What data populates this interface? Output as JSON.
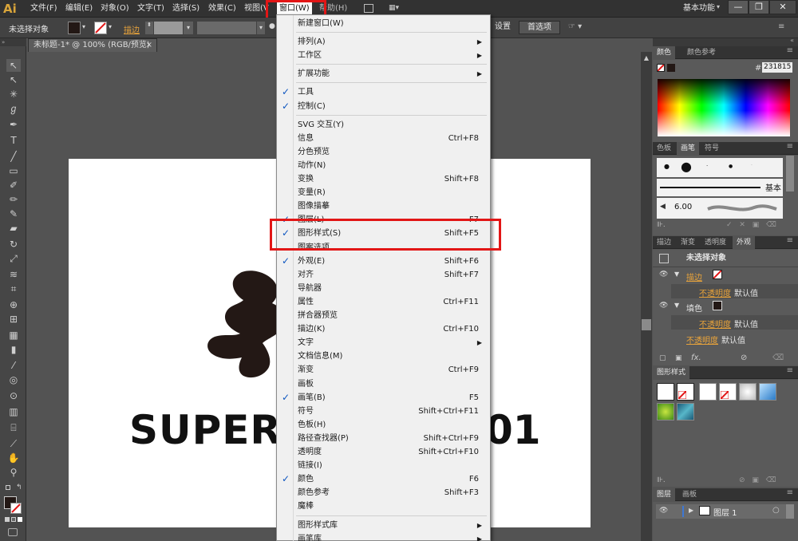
{
  "menubar": {
    "logo": "Ai",
    "items": [
      "文件(F)",
      "编辑(E)",
      "对象(O)",
      "文字(T)",
      "选择(S)",
      "效果(C)",
      "视图(V"
    ],
    "window_menu": "窗口(W)",
    "help_menu": "帮助(H)",
    "workspace": "基本功能"
  },
  "control": {
    "no_selection": "未选择对象",
    "stroke_label": "描边",
    "settings": "设置",
    "preferences": "首选项"
  },
  "document": {
    "tab": "未标题-1* @ 100% (RGB/预览)",
    "text_left": "SUPER",
    "text_right": "01"
  },
  "dropdown": {
    "items": [
      {
        "label": "新建窗口(W)",
        "shortcut": "",
        "check": false,
        "sub": false
      },
      {
        "sep": true
      },
      {
        "label": "排列(A)",
        "sub": true
      },
      {
        "label": "工作区",
        "sub": true
      },
      {
        "sep": true
      },
      {
        "label": "扩展功能",
        "sub": true
      },
      {
        "sep": true
      },
      {
        "label": "工具",
        "check": true
      },
      {
        "label": "控制(C)",
        "check": true
      },
      {
        "sep": true
      },
      {
        "label": "SVG 交互(Y)"
      },
      {
        "label": "信息",
        "shortcut": "Ctrl+F8"
      },
      {
        "label": "分色预览"
      },
      {
        "label": "动作(N)"
      },
      {
        "label": "变换",
        "shortcut": "Shift+F8"
      },
      {
        "label": "变量(R)"
      },
      {
        "label": "图像描摹"
      },
      {
        "label": "图层(L)",
        "shortcut": "F7",
        "check": true
      },
      {
        "label": "图形样式(S)",
        "shortcut": "Shift+F5",
        "check": true
      },
      {
        "label": "图案选项"
      },
      {
        "label": "外观(E)",
        "shortcut": "Shift+F6",
        "check": true
      },
      {
        "label": "对齐",
        "shortcut": "Shift+F7"
      },
      {
        "label": "导航器"
      },
      {
        "label": "属性",
        "shortcut": "Ctrl+F11"
      },
      {
        "label": "拼合器预览"
      },
      {
        "label": "描边(K)",
        "shortcut": "Ctrl+F10"
      },
      {
        "label": "文字",
        "sub": true
      },
      {
        "label": "文档信息(M)"
      },
      {
        "label": "渐变",
        "shortcut": "Ctrl+F9"
      },
      {
        "label": "画板"
      },
      {
        "label": "画笔(B)",
        "shortcut": "F5",
        "check": true
      },
      {
        "label": "符号",
        "shortcut": "Shift+Ctrl+F11"
      },
      {
        "label": "色板(H)"
      },
      {
        "label": "路径查找器(P)",
        "shortcut": "Shift+Ctrl+F9"
      },
      {
        "label": "透明度",
        "shortcut": "Shift+Ctrl+F10"
      },
      {
        "label": "链接(I)"
      },
      {
        "label": "颜色",
        "shortcut": "F6",
        "check": true
      },
      {
        "label": "颜色参考",
        "shortcut": "Shift+F3"
      },
      {
        "label": "魔棒"
      },
      {
        "sep": true
      },
      {
        "label": "图形样式库",
        "sub": true
      },
      {
        "label": "画笔库",
        "sub": true
      }
    ]
  },
  "panels": {
    "color": {
      "tabs": [
        "颜色",
        "颜色参考"
      ],
      "hex_label": "#",
      "hex": "231815"
    },
    "brushes": {
      "tabs": [
        "色板",
        "画笔",
        "符号"
      ],
      "basic": "基本",
      "size": "6.00"
    },
    "appearance": {
      "tabs": [
        "描边",
        "渐变",
        "透明度",
        "外观"
      ],
      "title": "未选择对象",
      "stroke": "描边",
      "opacity": "不透明度",
      "default": "默认值",
      "fill": "填色",
      "opacity2": "不透明度",
      "default2": "默认值",
      "opacity3": "不透明度",
      "default3": "默认值",
      "fx": "fx."
    },
    "graphic_styles": {
      "tabs": [
        "图形样式"
      ]
    },
    "layers": {
      "tabs": [
        "图层",
        "画板"
      ],
      "layer1": "图层 1"
    }
  },
  "colors": {
    "highlight": "#e21616",
    "accent": "#e8a33b"
  }
}
